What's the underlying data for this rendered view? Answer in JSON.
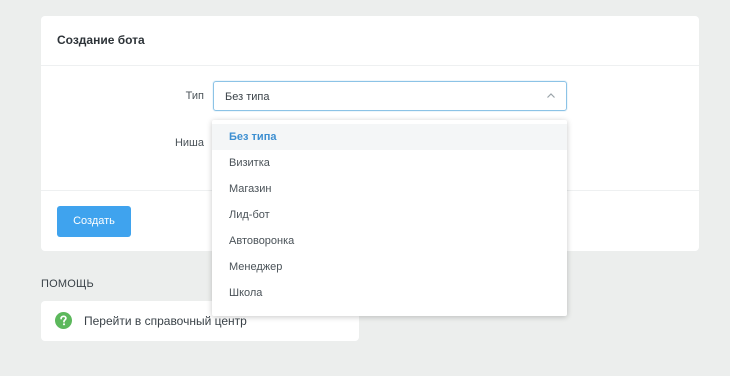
{
  "card": {
    "title": "Создание бота"
  },
  "form": {
    "type_label": "Тип",
    "niche_label": "Ниша",
    "type_value": "Без типа"
  },
  "dropdown": {
    "items": [
      {
        "label": "Без типа",
        "selected": true
      },
      {
        "label": "Визитка"
      },
      {
        "label": "Магазин"
      },
      {
        "label": "Лид-бот"
      },
      {
        "label": "Автоворонка"
      },
      {
        "label": "Менеджер"
      },
      {
        "label": "Школа"
      }
    ]
  },
  "actions": {
    "create_label": "Создать"
  },
  "help": {
    "heading": "ПОМОЩЬ",
    "link_label": "Перейти в справочный центр"
  },
  "colors": {
    "accent": "#3fa3ee",
    "selected_text": "#3d8fd1",
    "help_icon": "#5cb85c"
  },
  "icons": {
    "select_arrow": "chevron-up-icon",
    "help": "question-circle-icon"
  }
}
